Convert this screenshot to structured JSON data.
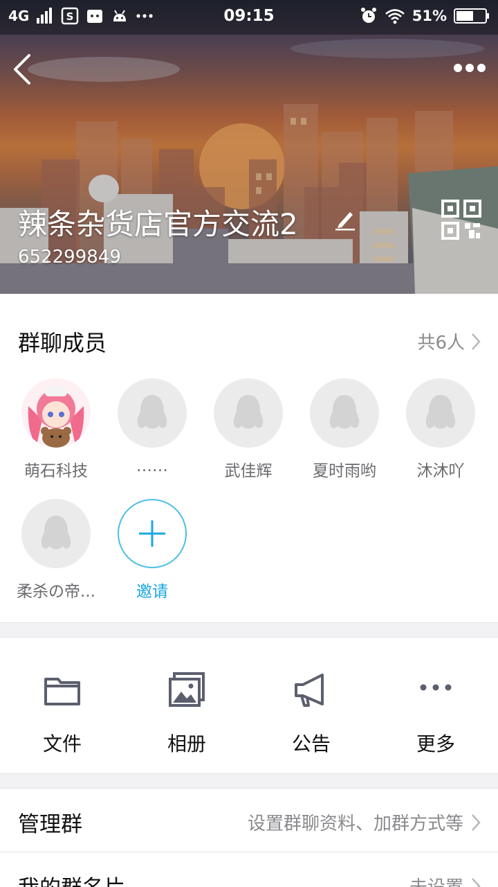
{
  "status_bar": {
    "network": "4G",
    "time": "09:15",
    "battery": "51%"
  },
  "header": {
    "group_name": "辣条杂货店官方交流2",
    "group_id": "652299849"
  },
  "members": {
    "title": "群聊成员",
    "count_label": "共6人",
    "list": [
      {
        "name": "萌石科技",
        "avatar": "anime-girl-avatar"
      },
      {
        "name": "……",
        "avatar": "default-penguin-avatar"
      },
      {
        "name": "武佳辉",
        "avatar": "default-penguin-avatar"
      },
      {
        "name": "夏时雨哟",
        "avatar": "default-penguin-avatar"
      },
      {
        "name": "沐沐吖",
        "avatar": "default-penguin-avatar"
      },
      {
        "name": "柔杀の帝...",
        "avatar": "default-penguin-avatar"
      }
    ],
    "invite_label": "邀请"
  },
  "tools": [
    {
      "label": "文件",
      "icon": "folder-icon"
    },
    {
      "label": "相册",
      "icon": "album-icon"
    },
    {
      "label": "公告",
      "icon": "megaphone-icon"
    },
    {
      "label": "更多",
      "icon": "more-dots-icon"
    }
  ],
  "settings": {
    "manage": {
      "label": "管理群",
      "value": "设置群聊资料、加群方式等"
    },
    "card": {
      "label": "我的群名片",
      "value": "未设置"
    }
  },
  "colors": {
    "accent": "#1aa7e0",
    "secondary_text": "#8a8a8e",
    "background": "#f2f2f4"
  }
}
